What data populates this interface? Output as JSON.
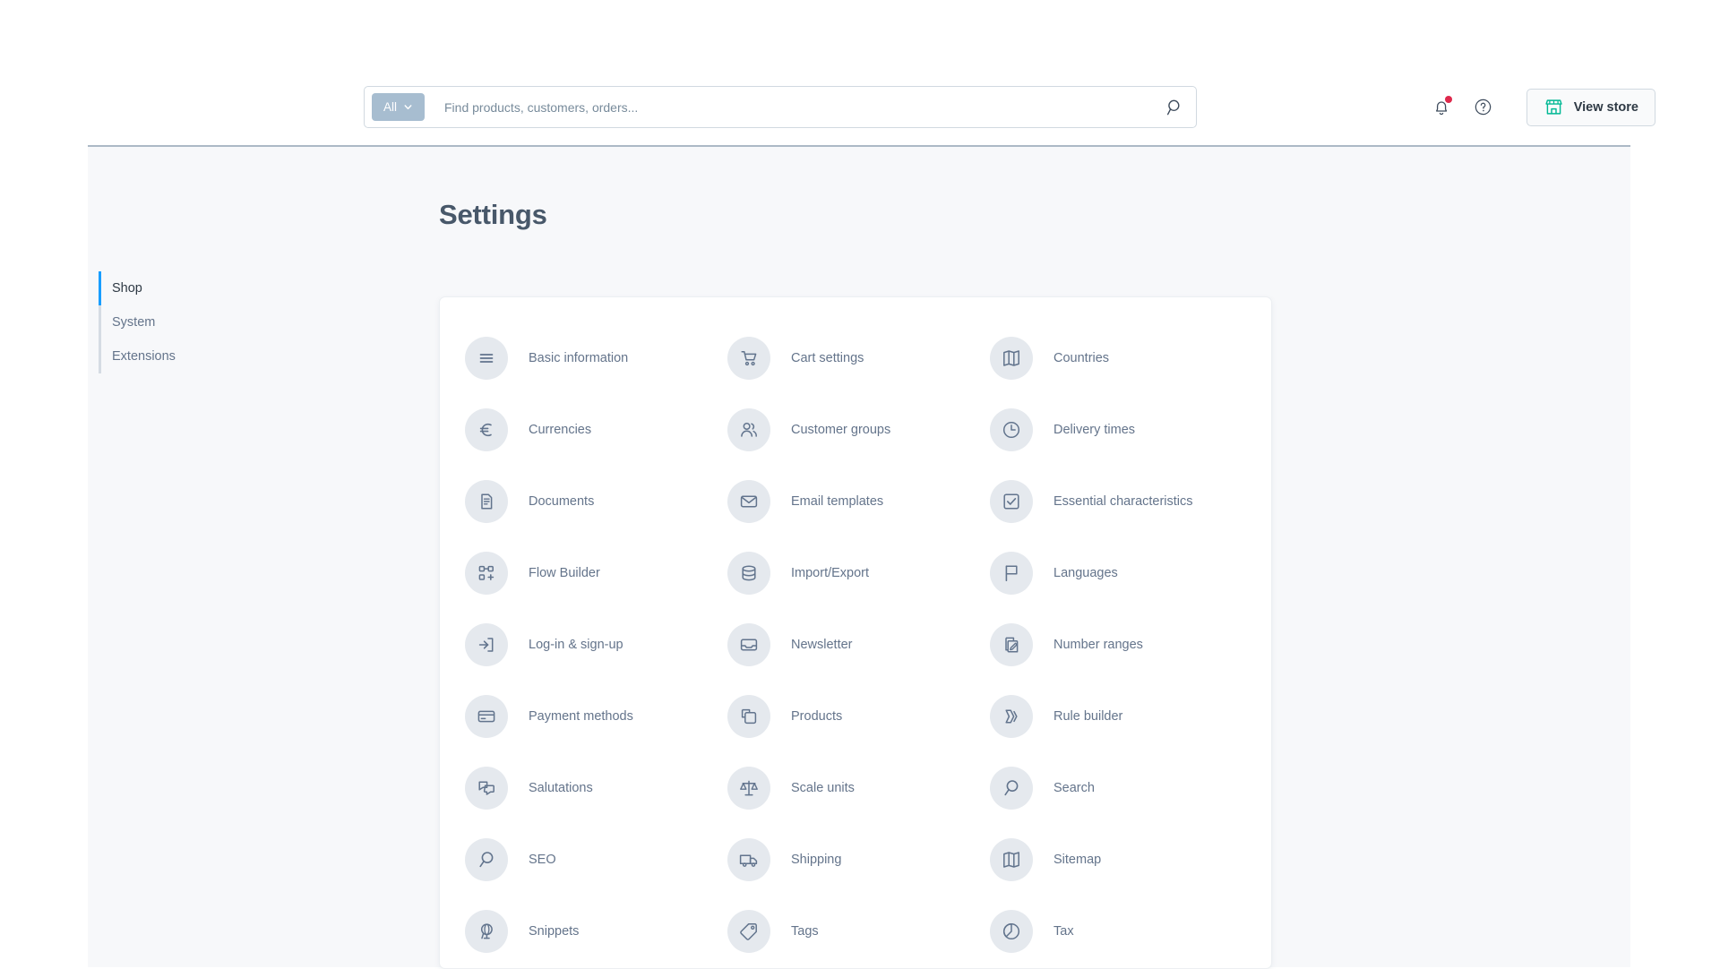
{
  "topbar": {
    "search": {
      "scope_label": "All",
      "scope_icon": "chevron-down-icon",
      "placeholder": "Find products, customers, orders...",
      "value": "",
      "submit_icon": "search-icon"
    },
    "actions": {
      "notifications_icon": "bell-icon",
      "notifications_has_badge": true,
      "help_icon": "question-circle-icon",
      "view_store_label": "View store",
      "view_store_icon": "storefront-icon",
      "view_store_icon_color": "#00b894"
    }
  },
  "page": {
    "title": "Settings"
  },
  "sidebar": {
    "items": [
      {
        "label": "Shop",
        "active": true
      },
      {
        "label": "System",
        "active": false
      },
      {
        "label": "Extensions",
        "active": false
      }
    ],
    "active_indicator_color": "#189eff"
  },
  "settings": {
    "columns": [
      [
        {
          "label": "Basic information",
          "icon": "hamburger-lines-icon"
        },
        {
          "label": "Currencies",
          "icon": "euro-icon"
        },
        {
          "label": "Documents",
          "icon": "document-icon"
        },
        {
          "label": "Flow Builder",
          "icon": "flow-nodes-icon"
        },
        {
          "label": "Log-in & sign-up",
          "icon": "login-arrow-icon"
        },
        {
          "label": "Payment methods",
          "icon": "credit-card-icon"
        },
        {
          "label": "Salutations",
          "icon": "speech-bubbles-icon"
        },
        {
          "label": "SEO",
          "icon": "magnifier-icon"
        },
        {
          "label": "Snippets",
          "icon": "globe-stand-icon"
        }
      ],
      [
        {
          "label": "Cart settings",
          "icon": "shopping-cart-icon"
        },
        {
          "label": "Customer groups",
          "icon": "users-group-icon"
        },
        {
          "label": "Email templates",
          "icon": "envelope-icon"
        },
        {
          "label": "Import/Export",
          "icon": "database-icon"
        },
        {
          "label": "Newsletter",
          "icon": "inbox-tray-icon"
        },
        {
          "label": "Products",
          "icon": "copy-squares-icon"
        },
        {
          "label": "Scale units",
          "icon": "balance-scale-icon"
        },
        {
          "label": "Shipping",
          "icon": "delivery-truck-icon"
        },
        {
          "label": "Tags",
          "icon": "price-tag-icon"
        }
      ],
      [
        {
          "label": "Countries",
          "icon": "folded-map-icon"
        },
        {
          "label": "Delivery times",
          "icon": "clock-icon"
        },
        {
          "label": "Essential characteristics",
          "icon": "checkbox-checked-icon"
        },
        {
          "label": "Languages",
          "icon": "flag-icon"
        },
        {
          "label": "Number ranges",
          "icon": "pencil-document-icon"
        },
        {
          "label": "Rule builder",
          "icon": "rule-chevron-icon"
        },
        {
          "label": "Search",
          "icon": "magnifier-icon"
        },
        {
          "label": "Sitemap",
          "icon": "folded-map-icon"
        },
        {
          "label": "Tax",
          "icon": "pie-chart-icon"
        }
      ]
    ]
  },
  "theme": {
    "icon_circle_bg": "#e5e9ee",
    "icon_stroke": "#62748d",
    "text_muted": "#64748b",
    "canvas_bg": "#f7f8fa",
    "card_bg": "#ffffff"
  }
}
